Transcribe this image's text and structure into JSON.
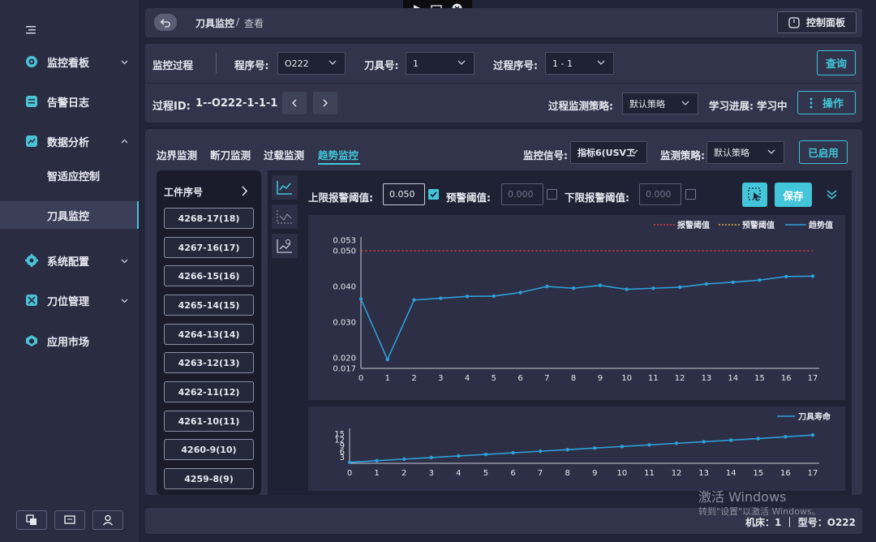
{
  "window_controls": [
    "arrow-icon",
    "window-icon",
    "close-icon"
  ],
  "sidebar": {
    "items": [
      {
        "label": "监控看板",
        "icon": "dashboard-icon",
        "chevron": "down"
      },
      {
        "label": "告警日志",
        "icon": "log-icon"
      },
      {
        "label": "数据分析",
        "icon": "analysis-icon",
        "chevron": "up"
      },
      {
        "label": "智适应控制",
        "sub": true
      },
      {
        "label": "刀具监控",
        "sub": true,
        "active": true
      },
      {
        "label": "系统配置",
        "icon": "gear-icon",
        "chevron": "down"
      },
      {
        "label": "刀位管理",
        "icon": "tool-icon",
        "chevron": "down"
      },
      {
        "label": "应用市场",
        "icon": "market-icon"
      }
    ]
  },
  "header": {
    "breadcrumb_main": "刀具监控",
    "breadcrumb_sep": "/",
    "breadcrumb_sub": "查看",
    "control_panel": "控制面板"
  },
  "filter": {
    "section_label": "监控过程",
    "program_label": "程序号:",
    "program_value": "O222",
    "tool_label": "刀具号:",
    "tool_value": "1",
    "process_label": "过程序号:",
    "process_value": "1 - 1",
    "query_button": "查询",
    "process_id_label": "过程ID:",
    "process_id_value": "1--O222-1-1-1",
    "strategy_label": "过程监测策略:",
    "strategy_value": "默认策略",
    "learning_label": "学习进展:",
    "learning_value": "学习中",
    "operate_button": "操作"
  },
  "tabs": [
    {
      "label": "边界监测"
    },
    {
      "label": "断刀监测"
    },
    {
      "label": "过载监测"
    },
    {
      "label": "趋势监控",
      "active": true
    }
  ],
  "signal": {
    "signal_label": "监控信号:",
    "signal_value": "指标6(USV工",
    "strategy_label": "监测策略:",
    "strategy_value": "默认策略",
    "enabled_button": "已启用"
  },
  "workpiece": {
    "header": "工件序号",
    "items": [
      "4268-17(18)",
      "4267-16(17)",
      "4266-15(16)",
      "4265-14(15)",
      "4264-13(14)",
      "4263-12(13)",
      "4262-11(12)",
      "4261-10(11)",
      "4260-9(10)",
      "4259-8(9)"
    ]
  },
  "thresholds": {
    "upper_label": "上限报警阈值:",
    "upper_value": "0.050",
    "upper_checked": true,
    "warn_label": "预警阈值:",
    "warn_placeholder": "0.000",
    "warn_checked": false,
    "lower_label": "下限报警阈值:",
    "lower_placeholder": "0.000",
    "lower_checked": false,
    "save_button": "保存"
  },
  "chart_data": [
    {
      "type": "line",
      "legend": [
        "报警阈值",
        "预警阈值",
        "趋势值"
      ],
      "x": [
        0,
        1,
        2,
        3,
        4,
        5,
        6,
        7,
        8,
        9,
        10,
        11,
        12,
        13,
        14,
        15,
        16,
        17
      ],
      "series": [
        {
          "name": "趋势值",
          "values": [
            0.0365,
            0.0195,
            0.0362,
            0.0367,
            0.0372,
            0.0373,
            0.0383,
            0.04,
            0.0395,
            0.0403,
            0.0392,
            0.0395,
            0.0398,
            0.0407,
            0.0412,
            0.0418,
            0.0428,
            0.0429
          ],
          "color": "#2f9fd8"
        },
        {
          "name": "报警阈值",
          "values": [
            0.05
          ],
          "color": "#e03c4a"
        }
      ],
      "yticks": [
        "0.053",
        "0.050",
        "0.040",
        "0.030",
        "0.020",
        "0.017"
      ],
      "ylim": [
        0.017,
        0.053
      ]
    },
    {
      "type": "line",
      "legend": [
        "刀具寿命"
      ],
      "x": [
        0,
        1,
        2,
        3,
        4,
        5,
        6,
        7,
        8,
        9,
        10,
        11,
        12,
        13,
        14,
        15,
        16,
        17
      ],
      "series": [
        {
          "name": "刀具寿命",
          "values": [
            0.5,
            1.3,
            2.1,
            2.9,
            3.7,
            4.5,
            5.3,
            6.1,
            6.9,
            7.7,
            8.5,
            9.3,
            10.1,
            10.9,
            11.7,
            12.5,
            13.4,
            14.3
          ],
          "color": "#2f9fd8"
        }
      ],
      "yticks": [
        "15",
        "12",
        "9",
        "6",
        "3"
      ],
      "ylim": [
        0,
        16
      ]
    }
  ],
  "footer": {
    "text": "机床：1 ｜ 型号：O222"
  },
  "watermark": {
    "line1": "激活 Windows",
    "line2": "转到\"设置\"以激活 Windows。"
  }
}
